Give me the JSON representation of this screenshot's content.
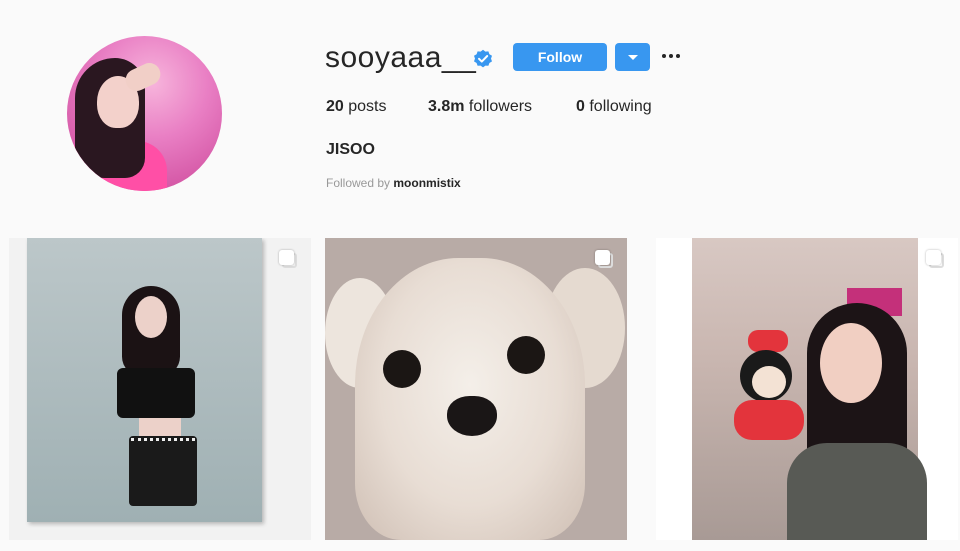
{
  "profile": {
    "username": "sooyaaa__",
    "verified": true,
    "follow_label": "Follow",
    "full_name": "JISOO",
    "followed_by_prefix": "Followed by",
    "followed_by_user": "moonmistix"
  },
  "stats": {
    "posts_count": "20",
    "posts_label": "posts",
    "followers_count": "3.8m",
    "followers_label": "followers",
    "following_count": "0",
    "following_label": "following"
  },
  "icons": {
    "verified": "verified-badge-icon",
    "dropdown": "caret-down-icon",
    "more": "more-options-icon",
    "multi": "multiple-photos-icon"
  },
  "colors": {
    "accent": "#3897f0",
    "background": "#fafafa",
    "text": "#262626",
    "muted": "#999999"
  }
}
